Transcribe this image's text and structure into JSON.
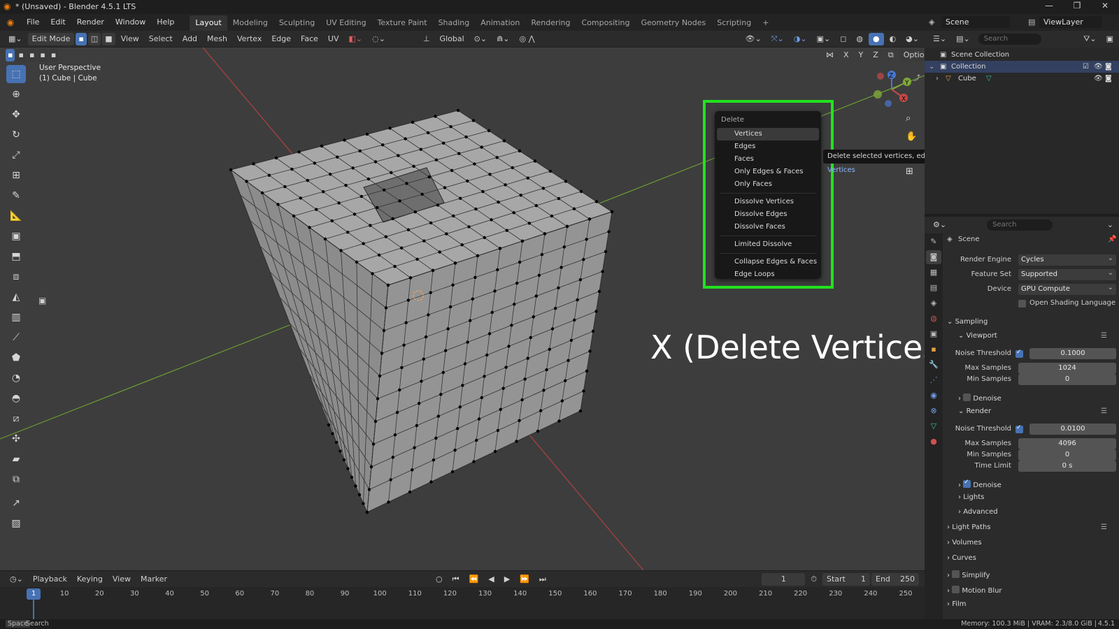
{
  "window": {
    "title": "* (Unsaved) - Blender 4.5.1 LTS",
    "controls": [
      "—",
      "❐",
      "✕"
    ]
  },
  "menu": [
    "File",
    "Edit",
    "Render",
    "Window",
    "Help"
  ],
  "workspaces": [
    "Layout",
    "Modeling",
    "Sculpting",
    "UV Editing",
    "Texture Paint",
    "Shading",
    "Animation",
    "Rendering",
    "Compositing",
    "Geometry Nodes",
    "Scripting",
    "+"
  ],
  "scene_field": "Scene",
  "viewlayer_field": "ViewLayer",
  "header": {
    "mode": "Edit Mode",
    "menus": [
      "View",
      "Select",
      "Add",
      "Mesh",
      "Vertex",
      "Edge",
      "Face",
      "UV"
    ],
    "orientation": "Global",
    "options": "Options",
    "axes": [
      "X",
      "Y",
      "Z"
    ]
  },
  "viewport": {
    "perspective": "User Perspective",
    "object": "(1) Cube | Cube",
    "caption": "X (Delete Vertices)",
    "gizmo": {
      "x": "X",
      "y": "Y",
      "z": "Z"
    },
    "colors": {
      "background": "#3d3d3d",
      "highlight": "#22e21e",
      "accent": "#4772b3"
    }
  },
  "delete_menu": {
    "title": "Delete",
    "group1": [
      "Vertices",
      "Edges",
      "Faces",
      "Only Edges & Faces",
      "Only Faces"
    ],
    "group2": [
      "Dissolve Vertices",
      "Dissolve Edges",
      "Dissolve Faces"
    ],
    "group3": [
      "Limited Dissolve"
    ],
    "group4": [
      "Collapse Edges & Faces",
      "Edge Loops"
    ]
  },
  "tooltip": {
    "text": "Delete selected vertices, edges or faces: ",
    "highlight": "Vertices"
  },
  "timeline": {
    "menus": [
      "Playback",
      "Keying",
      "View",
      "Marker"
    ],
    "current": "1",
    "start_label": "Start",
    "start": "1",
    "end_label": "End",
    "end": "250",
    "ticks": [
      "1",
      "10",
      "20",
      "30",
      "40",
      "50",
      "60",
      "70",
      "80",
      "90",
      "100",
      "110",
      "120",
      "130",
      "140",
      "150",
      "160",
      "170",
      "180",
      "190",
      "200",
      "210",
      "220",
      "230",
      "240",
      "250"
    ]
  },
  "status": {
    "left_key": "Space",
    "left_label": "Search",
    "right": "Memory: 100.3 MiB | VRAM: 2.3/8.0 GiB | ",
    "version": "4.5.1"
  },
  "outliner": {
    "search": "Search",
    "rows": [
      "Scene Collection",
      "Collection",
      "Cube"
    ]
  },
  "properties": {
    "search": "Search",
    "scene": "Scene",
    "render_engine_label": "Render Engine",
    "render_engine": "Cycles",
    "feature_set_label": "Feature Set",
    "feature_set": "Supported",
    "device_label": "Device",
    "device": "GPU Compute",
    "osl": "Open Shading Language",
    "sampling": "Sampling",
    "viewport": "Viewport",
    "vp_noise_label": "Noise Threshold",
    "vp_noise": "0.1000",
    "vp_max_label": "Max Samples",
    "vp_max": "1024",
    "vp_min_label": "Min Samples",
    "vp_min": "0",
    "denoise": "Denoise",
    "render": "Render",
    "r_noise_label": "Noise Threshold",
    "r_noise": "0.0100",
    "r_max_label": "Max Samples",
    "r_max": "4096",
    "r_min_label": "Min Samples",
    "r_min": "0",
    "time_limit_label": "Time Limit",
    "time_limit": "0 s",
    "r_denoise": "Denoise",
    "lights": "Lights",
    "advanced": "Advanced",
    "light_paths": "Light Paths",
    "volumes": "Volumes",
    "curves": "Curves",
    "simplify": "Simplify",
    "motion_blur": "Motion Blur",
    "film": "Film"
  }
}
